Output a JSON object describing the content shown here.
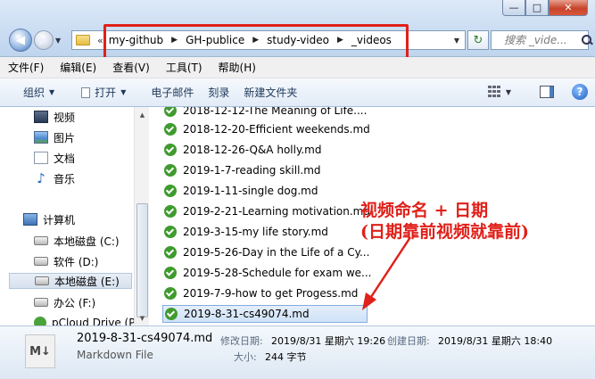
{
  "address": {
    "chevron": "«",
    "crumbs": [
      "my-github",
      "GH-publice",
      "study-video",
      "_videos"
    ],
    "search_placeholder": "搜索 _vide..."
  },
  "window_buttons": {
    "minimize": "—",
    "maximize": "□",
    "close": "✕"
  },
  "menu": [
    "文件(F)",
    "编辑(E)",
    "查看(V)",
    "工具(T)",
    "帮助(H)"
  ],
  "toolbar": {
    "organize": "组织",
    "open": "打开",
    "email": "电子邮件",
    "burn": "刻录",
    "new_folder": "新建文件夹"
  },
  "sidebar": {
    "libraries": [
      "视频",
      "图片",
      "文档",
      "音乐"
    ],
    "computer": "计算机",
    "drives": [
      "本地磁盘 (C:)",
      "软件 (D:)",
      "本地磁盘 (E:)",
      "办公 (F:)",
      "pCloud Drive (P"
    ]
  },
  "files": [
    "2018-12-12-The Meaning of Life....",
    "2018-12-20-Efficient weekends.md",
    "2018-12-26-Q&A holly.md",
    "2019-1-7-reading skill.md",
    "2019-1-11-single dog.md",
    "2019-2-21-Learning motivation.md",
    "2019-3-15-my life story.md",
    "2019-5-26-Day in the Life of a Cy...",
    "2019-5-28-Schedule for exam we...",
    "2019-7-9-how to get Progess.md",
    "2019-8-31-cs49074.md"
  ],
  "annotation": {
    "line1": "视频命名 + 日期",
    "line2": "(日期靠前视频就靠前)",
    "color": "#e0201a"
  },
  "details": {
    "icon_text": "M↓",
    "name": "2019-8-31-cs49074.md",
    "type": "Markdown File",
    "modified_label": "修改日期:",
    "modified_value": "2019/8/31 星期六 19:26",
    "created_label": "创建日期:",
    "created_value": "2019/8/31 星期六 18:40",
    "size_label": "大小:",
    "size_value": "244 字节"
  }
}
